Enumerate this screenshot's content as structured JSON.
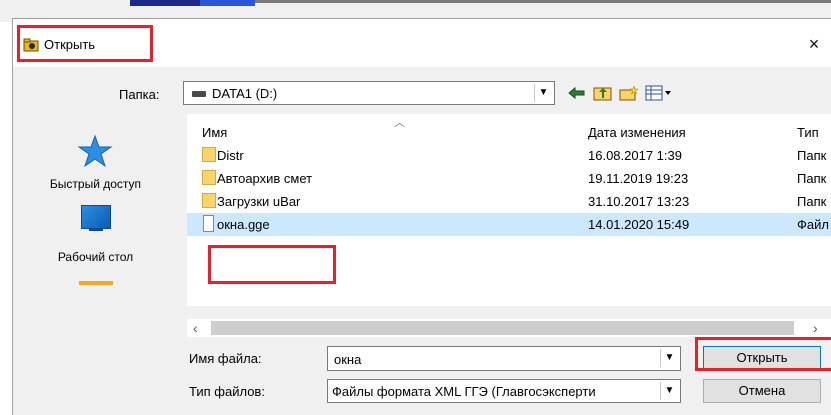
{
  "window": {
    "title": "Открыть",
    "close_glyph": "×"
  },
  "toolbar": {
    "folder_label": "Папка:",
    "folder_value": "DATA1 (D:)",
    "drive_icon": "drive-icon",
    "back_icon": "back-arrow-icon",
    "up_icon": "up-folder-icon",
    "new_folder_icon": "new-folder-icon",
    "view_icon": "view-menu-icon"
  },
  "places": [
    {
      "label": "Быстрый доступ",
      "icon": "star-icon"
    },
    {
      "label": "Рабочий стол",
      "icon": "desktop-icon"
    }
  ],
  "file_list": {
    "columns": [
      "Имя",
      "Дата изменения",
      "Тип"
    ],
    "rows": [
      {
        "name": "Distr",
        "date": "16.08.2017 1:39",
        "type": "Папк",
        "kind": "folder",
        "selected": false
      },
      {
        "name": "Автоархив смет",
        "date": "19.11.2019 19:23",
        "type": "Папк",
        "kind": "folder",
        "selected": false
      },
      {
        "name": "Загрузки uBar",
        "date": "31.10.2017 13:23",
        "type": "Папк",
        "kind": "folder",
        "selected": false
      },
      {
        "name": "окна.gge",
        "date": "14.01.2020 15:49",
        "type": "Файл",
        "kind": "file",
        "selected": true
      }
    ]
  },
  "fields": {
    "filename_label": "Имя файла:",
    "filename_value": "окна",
    "filetype_label": "Тип файлов:",
    "filetype_value": "Файлы формата XML ГГЭ (Главгосэксперти"
  },
  "buttons": {
    "open": "Открыть",
    "cancel": "Отмена"
  },
  "colors": {
    "highlight": "#e8202a",
    "selection": "#cce8ff",
    "accent": "#0078d7"
  }
}
